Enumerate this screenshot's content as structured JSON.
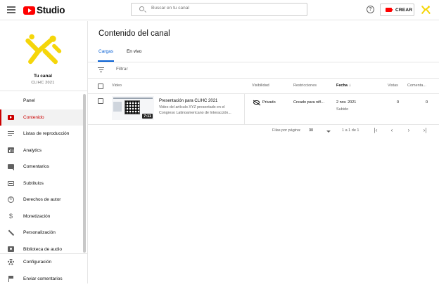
{
  "header": {
    "logo_text": "Studio",
    "search_placeholder": "Buscar en tu canal",
    "help_label": "?",
    "create_label": "CREAR"
  },
  "sidebar": {
    "channel_title": "Tu canal",
    "channel_subtitle": "CLIHC 2021",
    "items": [
      {
        "label": "Panel",
        "icon": "dashboard-icon"
      },
      {
        "label": "Contenido",
        "icon": "content-icon"
      },
      {
        "label": "Listas de reproducción",
        "icon": "playlist-icon"
      },
      {
        "label": "Analytics",
        "icon": "analytics-icon"
      },
      {
        "label": "Comentarios",
        "icon": "comments-icon"
      },
      {
        "label": "Subtítulos",
        "icon": "subtitles-icon"
      },
      {
        "label": "Derechos de autor",
        "icon": "copyright-icon"
      },
      {
        "label": "Monetización",
        "icon": "dollar-icon"
      },
      {
        "label": "Personalización",
        "icon": "magic-wand-icon"
      },
      {
        "label": "Biblioteca de audio",
        "icon": "audio-library-icon"
      }
    ],
    "bottom_items": [
      {
        "label": "Configuración",
        "icon": "gear-icon"
      },
      {
        "label": "Enviar comentarios",
        "icon": "feedback-icon"
      }
    ]
  },
  "main": {
    "title": "Contenido del canal",
    "tabs": [
      {
        "label": "Cargas",
        "active": true
      },
      {
        "label": "En vivo",
        "active": false
      }
    ],
    "filter_label": "Filtrar",
    "columns": {
      "video": "Video",
      "visibility": "Visibilidad",
      "restrictions": "Restricciones",
      "date": "Fecha",
      "views": "Vistas",
      "comments": "Comenta..."
    },
    "rows": [
      {
        "title": "Presentación para CLIHC 2021",
        "description": "Video del artículo XYZ presentado en el Congreso Latinoamericano de Interacción...",
        "duration": "7:11",
        "visibility": "Privado",
        "restrictions": "Creado para niñ...",
        "date": "2 nov. 2021",
        "date_status": "Subido",
        "views": "0",
        "comments": "0"
      }
    ],
    "pagination": {
      "rows_per_page_label": "Filas por página:",
      "rows_per_page_value": "30",
      "range": "1 a 1 de 1",
      "first": "|‹",
      "prev": "‹",
      "next": "›",
      "last": "›|"
    }
  },
  "colors": {
    "accent_red": "#ff0000",
    "active_red": "#cc0000",
    "tab_blue": "#065fd4",
    "avatar_yellow": "#f5d60a"
  }
}
